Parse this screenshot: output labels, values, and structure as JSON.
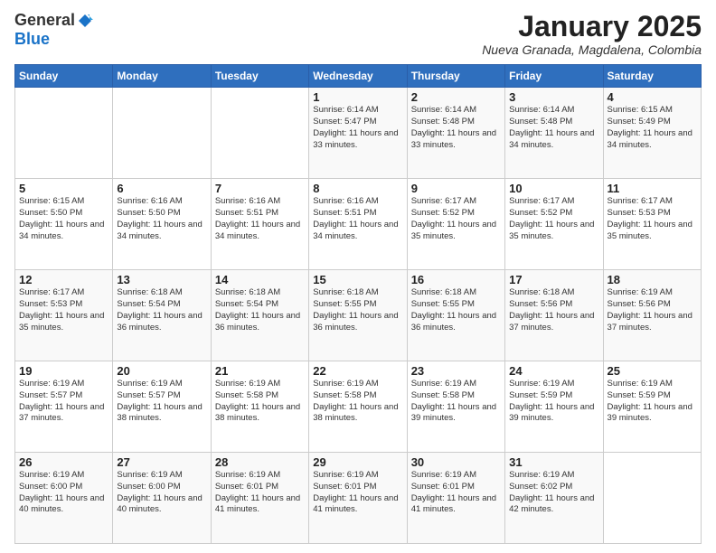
{
  "header": {
    "logo_general": "General",
    "logo_blue": "Blue",
    "month_title": "January 2025",
    "location": "Nueva Granada, Magdalena, Colombia"
  },
  "days_of_week": [
    "Sunday",
    "Monday",
    "Tuesday",
    "Wednesday",
    "Thursday",
    "Friday",
    "Saturday"
  ],
  "weeks": [
    [
      {
        "day": "",
        "info": ""
      },
      {
        "day": "",
        "info": ""
      },
      {
        "day": "",
        "info": ""
      },
      {
        "day": "1",
        "info": "Sunrise: 6:14 AM\nSunset: 5:47 PM\nDaylight: 11 hours\nand 33 minutes."
      },
      {
        "day": "2",
        "info": "Sunrise: 6:14 AM\nSunset: 5:48 PM\nDaylight: 11 hours\nand 33 minutes."
      },
      {
        "day": "3",
        "info": "Sunrise: 6:14 AM\nSunset: 5:48 PM\nDaylight: 11 hours\nand 34 minutes."
      },
      {
        "day": "4",
        "info": "Sunrise: 6:15 AM\nSunset: 5:49 PM\nDaylight: 11 hours\nand 34 minutes."
      }
    ],
    [
      {
        "day": "5",
        "info": "Sunrise: 6:15 AM\nSunset: 5:50 PM\nDaylight: 11 hours\nand 34 minutes."
      },
      {
        "day": "6",
        "info": "Sunrise: 6:16 AM\nSunset: 5:50 PM\nDaylight: 11 hours\nand 34 minutes."
      },
      {
        "day": "7",
        "info": "Sunrise: 6:16 AM\nSunset: 5:51 PM\nDaylight: 11 hours\nand 34 minutes."
      },
      {
        "day": "8",
        "info": "Sunrise: 6:16 AM\nSunset: 5:51 PM\nDaylight: 11 hours\nand 34 minutes."
      },
      {
        "day": "9",
        "info": "Sunrise: 6:17 AM\nSunset: 5:52 PM\nDaylight: 11 hours\nand 35 minutes."
      },
      {
        "day": "10",
        "info": "Sunrise: 6:17 AM\nSunset: 5:52 PM\nDaylight: 11 hours\nand 35 minutes."
      },
      {
        "day": "11",
        "info": "Sunrise: 6:17 AM\nSunset: 5:53 PM\nDaylight: 11 hours\nand 35 minutes."
      }
    ],
    [
      {
        "day": "12",
        "info": "Sunrise: 6:17 AM\nSunset: 5:53 PM\nDaylight: 11 hours\nand 35 minutes."
      },
      {
        "day": "13",
        "info": "Sunrise: 6:18 AM\nSunset: 5:54 PM\nDaylight: 11 hours\nand 36 minutes."
      },
      {
        "day": "14",
        "info": "Sunrise: 6:18 AM\nSunset: 5:54 PM\nDaylight: 11 hours\nand 36 minutes."
      },
      {
        "day": "15",
        "info": "Sunrise: 6:18 AM\nSunset: 5:55 PM\nDaylight: 11 hours\nand 36 minutes."
      },
      {
        "day": "16",
        "info": "Sunrise: 6:18 AM\nSunset: 5:55 PM\nDaylight: 11 hours\nand 36 minutes."
      },
      {
        "day": "17",
        "info": "Sunrise: 6:18 AM\nSunset: 5:56 PM\nDaylight: 11 hours\nand 37 minutes."
      },
      {
        "day": "18",
        "info": "Sunrise: 6:19 AM\nSunset: 5:56 PM\nDaylight: 11 hours\nand 37 minutes."
      }
    ],
    [
      {
        "day": "19",
        "info": "Sunrise: 6:19 AM\nSunset: 5:57 PM\nDaylight: 11 hours\nand 37 minutes."
      },
      {
        "day": "20",
        "info": "Sunrise: 6:19 AM\nSunset: 5:57 PM\nDaylight: 11 hours\nand 38 minutes."
      },
      {
        "day": "21",
        "info": "Sunrise: 6:19 AM\nSunset: 5:58 PM\nDaylight: 11 hours\nand 38 minutes."
      },
      {
        "day": "22",
        "info": "Sunrise: 6:19 AM\nSunset: 5:58 PM\nDaylight: 11 hours\nand 38 minutes."
      },
      {
        "day": "23",
        "info": "Sunrise: 6:19 AM\nSunset: 5:58 PM\nDaylight: 11 hours\nand 39 minutes."
      },
      {
        "day": "24",
        "info": "Sunrise: 6:19 AM\nSunset: 5:59 PM\nDaylight: 11 hours\nand 39 minutes."
      },
      {
        "day": "25",
        "info": "Sunrise: 6:19 AM\nSunset: 5:59 PM\nDaylight: 11 hours\nand 39 minutes."
      }
    ],
    [
      {
        "day": "26",
        "info": "Sunrise: 6:19 AM\nSunset: 6:00 PM\nDaylight: 11 hours\nand 40 minutes."
      },
      {
        "day": "27",
        "info": "Sunrise: 6:19 AM\nSunset: 6:00 PM\nDaylight: 11 hours\nand 40 minutes."
      },
      {
        "day": "28",
        "info": "Sunrise: 6:19 AM\nSunset: 6:01 PM\nDaylight: 11 hours\nand 41 minutes."
      },
      {
        "day": "29",
        "info": "Sunrise: 6:19 AM\nSunset: 6:01 PM\nDaylight: 11 hours\nand 41 minutes."
      },
      {
        "day": "30",
        "info": "Sunrise: 6:19 AM\nSunset: 6:01 PM\nDaylight: 11 hours\nand 41 minutes."
      },
      {
        "day": "31",
        "info": "Sunrise: 6:19 AM\nSunset: 6:02 PM\nDaylight: 11 hours\nand 42 minutes."
      },
      {
        "day": "",
        "info": ""
      }
    ]
  ]
}
